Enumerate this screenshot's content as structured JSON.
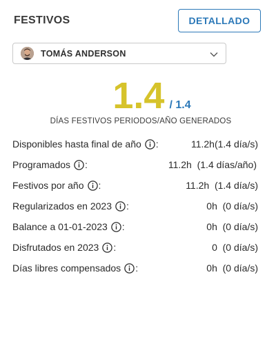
{
  "header": {
    "title": "FESTIVOS",
    "detail_button": "DETALLADO"
  },
  "user_select": {
    "name": "TOMÁS ANDERSON"
  },
  "summary": {
    "value": "1.4",
    "total": "/ 1.4",
    "caption": "DÍAS FESTIVOS PERIODOS/AÑO GENERADOS"
  },
  "rows": [
    {
      "label": "Disponibles hasta final de año",
      "colon": ":",
      "value": "11.2h(1.4 día/s)"
    },
    {
      "label": "Programados",
      "colon": ":",
      "value": "11.2h  (1.4 días/año)"
    },
    {
      "label": "Festivos por año",
      "colon": ":",
      "value": "11.2h  (1.4 día/s)"
    },
    {
      "label": "Regularizados en 2023",
      "colon": ":",
      "value": "0h  (0 día/s)"
    },
    {
      "label": "Balance a 01-01-2023",
      "colon": ":",
      "value": "0h  (0 día/s)"
    },
    {
      "label": "Disfrutados en 2023",
      "colon": ":",
      "value": "0  (0 día/s)"
    },
    {
      "label": "Días libres compensados",
      "colon": ":",
      "value": "0h  (0 día/s)"
    }
  ],
  "colors": {
    "accent_blue": "#2b78b8",
    "value_yellow": "#d6c32b"
  },
  "icons": {
    "info": "info-circle-icon",
    "dropdown": "chevron-down-icon",
    "avatar": "user-avatar"
  }
}
